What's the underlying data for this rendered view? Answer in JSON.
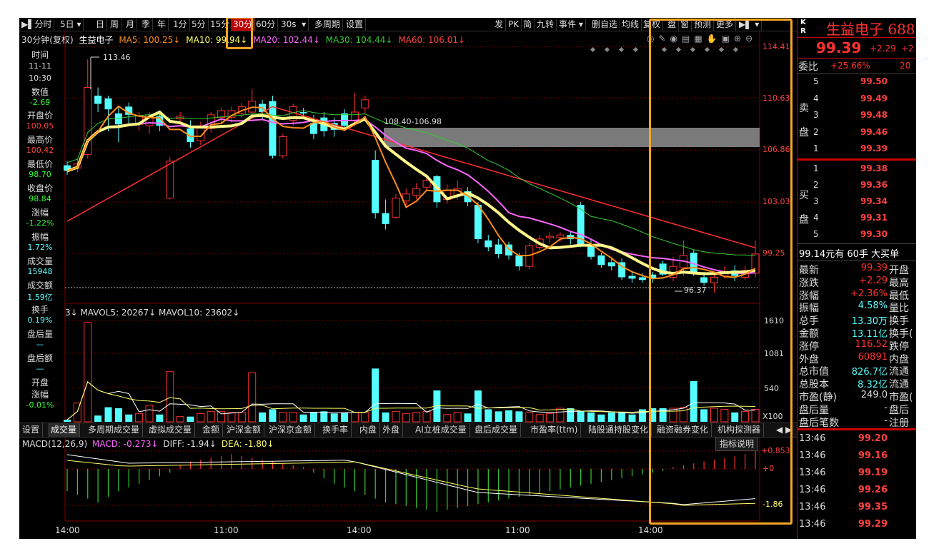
{
  "toolbar": {
    "items": [
      "分时",
      "5日",
      "日",
      "周",
      "月",
      "季",
      "年",
      "1分",
      "5分",
      "15分",
      "30分",
      "60分",
      "30s",
      "多周期",
      "设置"
    ],
    "active": "30分",
    "right_items": [
      "发",
      "PK",
      "简",
      "九转",
      "事件",
      "删自选",
      "均线",
      "复权",
      "盘",
      "窗",
      "预测",
      "更多"
    ]
  },
  "header_line": {
    "period": "30分钟(复权)",
    "stock": "生益电子",
    "ma5": "MA5: 100.25↓",
    "ma10": "MA10: 99.94↓",
    "ma20": "MA20: 102.44↓",
    "ma30": "MA30: 104.44↓",
    "ma60": "MA60: 106.01↓"
  },
  "left_info": {
    "time_label": "时间",
    "date": "11-11",
    "time": "10:30",
    "value_label": "数值",
    "value": "-2.69",
    "open_label": "开盘价",
    "open": "100.05",
    "high_label": "最高价",
    "high": "100.42",
    "low_label": "最低价",
    "low": "98.70",
    "close_label": "收盘价",
    "close": "98.84",
    "chg_label": "涨幅",
    "chg": "-1.22%",
    "amp_label": "振幅",
    "amp": "1.72%",
    "vol_label": "成交量",
    "vol": "15948",
    "amt_label": "成交额",
    "amt": "1.59亿",
    "turn_label": "换手",
    "turn": "0.19%",
    "after_vol_label": "盘后量",
    "after_vol": "—",
    "after_amt_label": "盘后额",
    "after_amt": "—",
    "open_chg_label1": "开盘",
    "open_chg_label2": "涨幅",
    "open_chg": "-0.01%"
  },
  "chart_data": {
    "type": "candlestick",
    "y_ticks": [
      "114.41",
      "110.63",
      "106.86",
      "103.03",
      "99.25"
    ],
    "annotations": [
      "113.46",
      "108.40-106.98",
      "96.37"
    ],
    "x_labels": [
      "14:00",
      "11:00",
      "14:00",
      "11:00",
      "14:00"
    ],
    "volume_header": "3↓ MAVOL5: 20267↓ MAVOL10: 23602↓",
    "volume_ticks": [
      "1610",
      "1081",
      "540",
      "X100"
    ],
    "macd_header_label": "MACD(12,26,9)",
    "macd_value": "MACD: -0.273↓",
    "diff_value": "DIFF: -1.94↓",
    "dea_value": "DEA: -1.80↓",
    "macd_ticks": [
      "+0.853",
      "+0",
      "-1.86"
    ],
    "indicator_btn": "指标说明"
  },
  "tabs": [
    "设置",
    "成交量",
    "多周期成交量",
    "虚拟成交量",
    "金额",
    "沪深金额",
    "沪深京金额",
    "换手率",
    "内盘",
    "外盘",
    "AI立桩成交量",
    "盘后成交量",
    "市盈率(ttm)",
    "陆股通持股变化",
    "融资融券变化",
    "机构探测器"
  ],
  "right": {
    "kr_k": "K",
    "kr_r": "R",
    "name": "生益电子",
    "code": "688",
    "price": "99.39",
    "change": "+2.29",
    "change_pct": "+2.",
    "weibi_label": "委比",
    "weibi": "+25.66%",
    "weibi_num": "20",
    "sell_label": "卖盘",
    "sell": [
      {
        "n": "5",
        "p": "99.50"
      },
      {
        "n": "4",
        "p": "99.49"
      },
      {
        "n": "3",
        "p": "99.48"
      },
      {
        "n": "2",
        "p": "99.46"
      },
      {
        "n": "1",
        "p": "99.39"
      }
    ],
    "buy_label": "买盘",
    "buy": [
      {
        "n": "1",
        "p": "99.38"
      },
      {
        "n": "2",
        "p": "99.36"
      },
      {
        "n": "3",
        "p": "99.34"
      },
      {
        "n": "4",
        "p": "99.31"
      },
      {
        "n": "5",
        "p": "99.30"
      }
    ],
    "big_order": "99.14元有 60手 大买单",
    "stats": [
      {
        "l": "最新",
        "v": "99.39",
        "r": "开盘"
      },
      {
        "l": "涨跌",
        "v": "+2.29",
        "r": "最高"
      },
      {
        "l": "涨幅",
        "v": "+2.36%",
        "r": "最低"
      },
      {
        "l": "振幅",
        "v": "4.58%",
        "r": "量比"
      },
      {
        "l": "总手",
        "v": "13.30万",
        "r": "换手"
      },
      {
        "l": "金额",
        "v": "13.11亿",
        "r": "换手("
      },
      {
        "l": "涨停",
        "v": "116.52",
        "r": "跌停"
      },
      {
        "l": "外盘",
        "v": "60891",
        "r": "内盘"
      },
      {
        "l": "总市值",
        "v": "826.7亿",
        "r": "流通"
      },
      {
        "l": "总股本",
        "v": "8.32亿",
        "r": "流通"
      },
      {
        "l": "市盈(静)",
        "v": "249.0",
        "r": "市盈("
      },
      {
        "l": "盘后量",
        "v": "-",
        "r": "盘后"
      },
      {
        "l": "盘后笔数",
        "v": "-",
        "r": "注册"
      }
    ],
    "ticks": [
      {
        "t": "13:46",
        "p": "99.20"
      },
      {
        "t": "13:46",
        "p": "99.16"
      },
      {
        "t": "13:46",
        "p": "99.19"
      },
      {
        "t": "13:46",
        "p": "99.26"
      },
      {
        "t": "13:46",
        "p": "99.35"
      },
      {
        "t": "13:46",
        "p": "99.29"
      }
    ]
  },
  "colors": {
    "up": "#ff3030",
    "down": "#54ffff",
    "ma5": "#ffffff",
    "ma10": "#ff8c1a",
    "ma20": "#ff66ff",
    "ma30": "#33cc33",
    "ma60": "#ff3030",
    "thick": "#fff68a",
    "highlight": "#f5a623"
  }
}
